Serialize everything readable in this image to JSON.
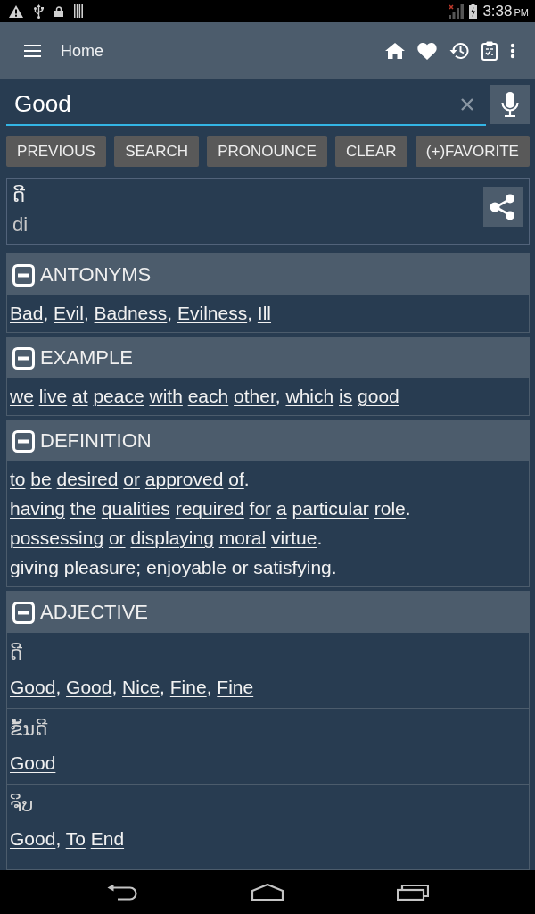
{
  "status_bar": {
    "time": "3:38",
    "meridiem": "PM"
  },
  "app_bar": {
    "title": "Home"
  },
  "search": {
    "value": "Good"
  },
  "buttons": [
    "PREVIOUS",
    "SEARCH",
    "PRONOUNCE",
    "CLEAR",
    "(+)FAVORITE"
  ],
  "word": {
    "lao": "ດີ",
    "romanization": "di"
  },
  "sections": [
    {
      "kind": "links",
      "title": "ANTONYMS",
      "expanded": true,
      "lines": [
        "Bad, Evil, Badness, Evilness, Ill"
      ]
    },
    {
      "kind": "links",
      "title": "EXAMPLE",
      "expanded": true,
      "lines": [
        "we live at peace with each other, which is good"
      ]
    },
    {
      "kind": "links",
      "title": "DEFINITION",
      "expanded": true,
      "lines": [
        "to be desired or approved of.",
        "having the qualities required for a particular role.",
        "possessing or displaying moral virtue.",
        "giving pleasure; enjoyable or satisfying."
      ]
    },
    {
      "kind": "entries",
      "title": "ADJECTIVE",
      "expanded": true,
      "entries": [
        {
          "word": "ດີ",
          "translations": "Good, Good, Nice, Fine, Fine"
        },
        {
          "word": "ຂັ້ນດີ",
          "translations": "Good"
        },
        {
          "word": "ຈິບ",
          "translations": "Good, To End"
        }
      ]
    }
  ]
}
